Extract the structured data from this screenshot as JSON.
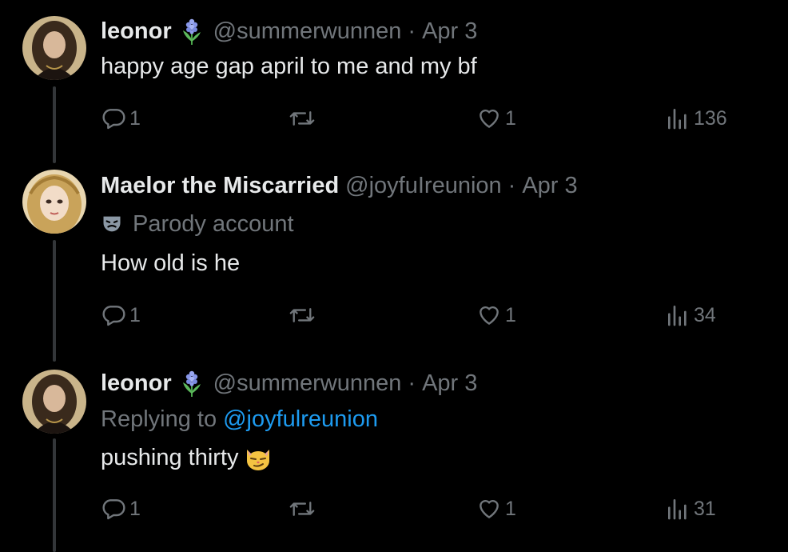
{
  "tweets": [
    {
      "display_name": "leonor",
      "badge_icon": "hyacinth-flower-icon",
      "handle": "@summerwunnen",
      "separator": "·",
      "date": "Apr 3",
      "text": "happy age gap april to me and my bf",
      "actions": {
        "replies": "1",
        "retweets": "",
        "likes": "1",
        "views": "136"
      }
    },
    {
      "display_name": "Maelor the Miscarried",
      "handle": "@joyfuIreunion",
      "separator": "·",
      "date": "Apr 3",
      "label_icon": "parody-mask-icon",
      "label": "Parody account",
      "text": "How old is he",
      "actions": {
        "replies": "1",
        "retweets": "",
        "likes": "1",
        "views": "34"
      }
    },
    {
      "display_name": "leonor",
      "badge_icon": "hyacinth-flower-icon",
      "handle": "@summerwunnen",
      "separator": "·",
      "date": "Apr 3",
      "replying_prefix": "Replying to",
      "replying_to": "@joyfulreunion",
      "text": "pushing thirty",
      "emoji_icon": "smirking-cat-icon",
      "actions": {
        "replies": "1",
        "retweets": "",
        "likes": "1",
        "views": "31"
      }
    }
  ],
  "colors": {
    "background": "#000000",
    "primary_text": "#e7e9ea",
    "secondary_text": "#71767b",
    "link": "#1d9bf0",
    "thread_line": "#333639"
  }
}
